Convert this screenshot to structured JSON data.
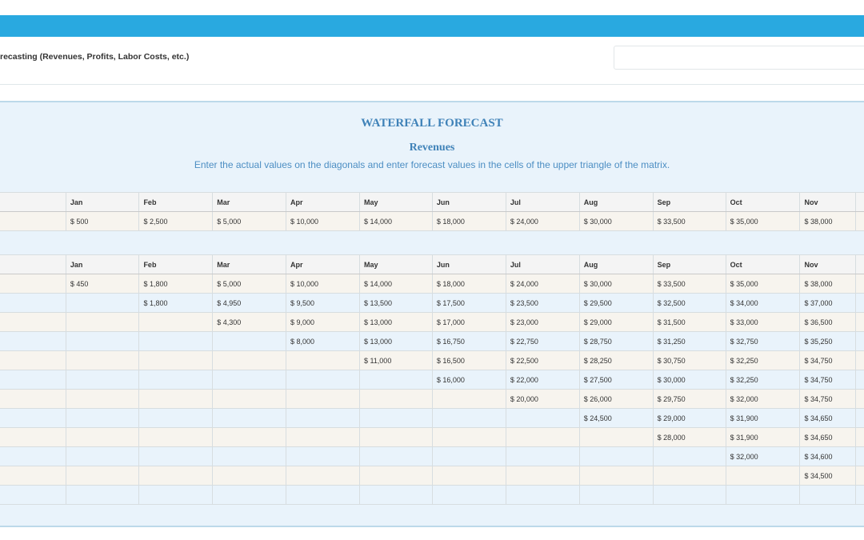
{
  "header": {
    "title_partial": "recasting (Revenues, Profits, Labor Costs, etc.)",
    "search_value": ""
  },
  "forecast": {
    "title": "WATERFALL FORECAST",
    "subtitle": "Revenues",
    "instructions": "Enter the actual values on the diagonals and enter forecast values in the cells of the upper triangle of the matrix."
  },
  "months": [
    "Jan",
    "Feb",
    "Mar",
    "Apr",
    "May",
    "Jun",
    "Jul",
    "Aug",
    "Sep",
    "Oct",
    "Nov"
  ],
  "actuals_row": [
    "$ 500",
    "$ 2,500",
    "$ 5,000",
    "$ 10,000",
    "$ 14,000",
    "$ 18,000",
    "$ 24,000",
    "$ 30,000",
    "$ 33,500",
    "$ 35,000",
    "$ 38,000"
  ],
  "matrix_rows": [
    [
      "$ 450",
      "$ 1,800",
      "$ 5,000",
      "$ 10,000",
      "$ 14,000",
      "$ 18,000",
      "$ 24,000",
      "$ 30,000",
      "$ 33,500",
      "$ 35,000",
      "$ 38,000"
    ],
    [
      "",
      "$ 1,800",
      "$ 4,950",
      "$ 9,500",
      "$ 13,500",
      "$ 17,500",
      "$ 23,500",
      "$ 29,500",
      "$ 32,500",
      "$ 34,000",
      "$ 37,000"
    ],
    [
      "",
      "",
      "$ 4,300",
      "$ 9,000",
      "$ 13,000",
      "$ 17,000",
      "$ 23,000",
      "$ 29,000",
      "$ 31,500",
      "$ 33,000",
      "$ 36,500"
    ],
    [
      "",
      "",
      "",
      "$ 8,000",
      "$ 13,000",
      "$ 16,750",
      "$ 22,750",
      "$ 28,750",
      "$ 31,250",
      "$ 32,750",
      "$ 35,250"
    ],
    [
      "",
      "",
      "",
      "",
      "$ 11,000",
      "$ 16,500",
      "$ 22,500",
      "$ 28,250",
      "$ 30,750",
      "$ 32,250",
      "$ 34,750"
    ],
    [
      "",
      "",
      "",
      "",
      "",
      "$ 16,000",
      "$ 22,000",
      "$ 27,500",
      "$ 30,000",
      "$ 32,250",
      "$ 34,750"
    ],
    [
      "",
      "",
      "",
      "",
      "",
      "",
      "$ 20,000",
      "$ 26,000",
      "$ 29,750",
      "$ 32,000",
      "$ 34,750"
    ],
    [
      "",
      "",
      "",
      "",
      "",
      "",
      "",
      "$ 24,500",
      "$ 29,000",
      "$ 31,900",
      "$ 34,650"
    ],
    [
      "",
      "",
      "",
      "",
      "",
      "",
      "",
      "",
      "$ 28,000",
      "$ 31,900",
      "$ 34,650"
    ],
    [
      "",
      "",
      "",
      "",
      "",
      "",
      "",
      "",
      "",
      "$ 32,000",
      "$ 34,600"
    ],
    [
      "",
      "",
      "",
      "",
      "",
      "",
      "",
      "",
      "",
      "",
      "$ 34,500"
    ],
    [
      "",
      "",
      "",
      "",
      "",
      "",
      "",
      "",
      "",
      "",
      ""
    ]
  ],
  "colors": {
    "topbar": "#29a9e0",
    "panel_bg": "#e9f3fb",
    "title": "#3f82b8",
    "row_alt": "#f7f4ee"
  }
}
